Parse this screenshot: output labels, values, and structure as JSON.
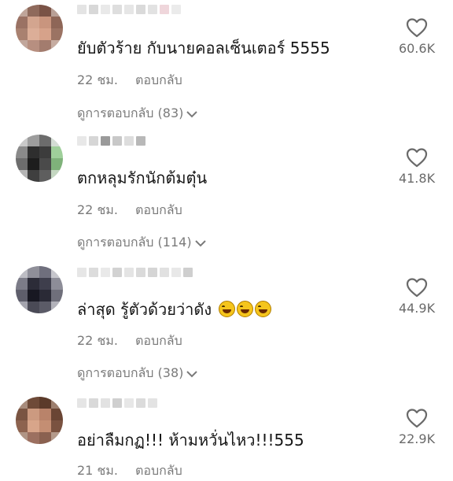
{
  "comments": [
    {
      "text": "ยับตัวร้าย กับนายคอลเซ็นเตอร์ 5555",
      "time": "22 ชม.",
      "reply_label": "ตอบกลับ",
      "view_replies": "ดูการตอบกลับ (83)",
      "likes": "60.6K",
      "liked": false
    },
    {
      "text": "ตกหลุมรักนักต้มตุ๋น",
      "time": "22 ชม.",
      "reply_label": "ตอบกลับ",
      "view_replies": "ดูการตอบกลับ (114)",
      "likes": "41.8K",
      "liked": false
    },
    {
      "text": "ล่าสุด รู้ตัวด้วยว่าดัง",
      "emoji": [
        "grinning-squinting-face",
        "grinning-squinting-face",
        "grinning-squinting-face"
      ],
      "time": "22 ชม.",
      "reply_label": "ตอบกลับ",
      "view_replies": "ดูการตอบกลับ (38)",
      "likes": "44.9K",
      "liked": false
    },
    {
      "text": "อย่าลืมกฏ!!! ห้ามหวั่นไหว!!!555",
      "time": "21 ชม.",
      "reply_label": "ตอบกลับ",
      "likes": "22.9K",
      "liked": false
    }
  ],
  "icons": {
    "like": "heart-outline-icon",
    "expand": "chevron-down-icon"
  },
  "colors": {
    "text_primary": "#161616",
    "text_secondary": "#7a7a7a",
    "icon": "#6a6a6a",
    "background": "#ffffff"
  }
}
